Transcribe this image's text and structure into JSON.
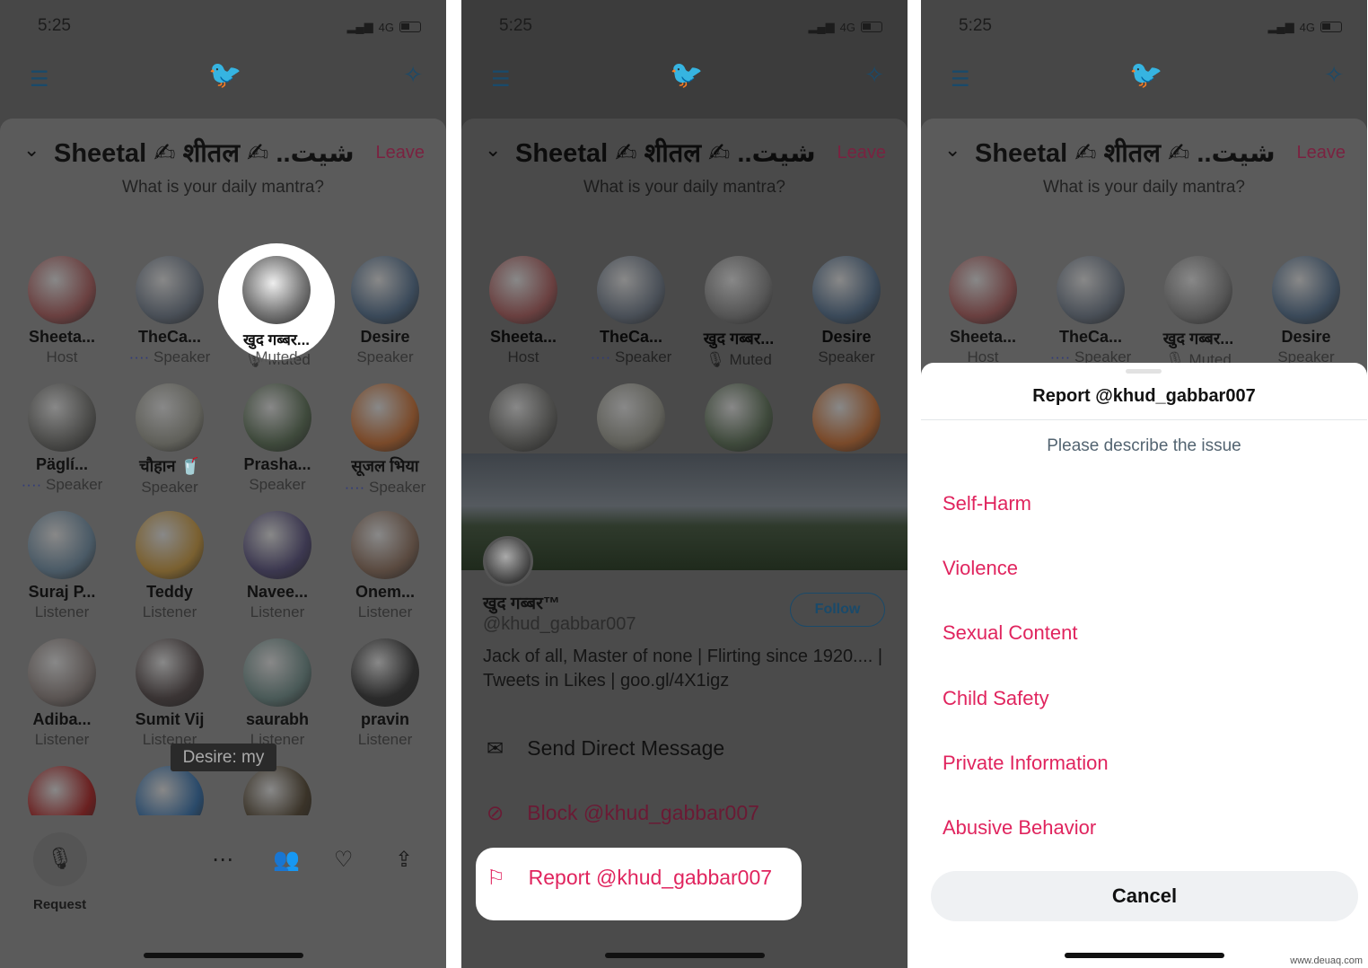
{
  "status": {
    "time": "5:25",
    "network": "4G"
  },
  "space": {
    "title": "Sheetal ✍ शीतल ✍ ..شيت",
    "leave": "Leave",
    "subtitle": "What is your daily mantra?"
  },
  "participants": [
    {
      "name": "Sheeta...",
      "role": "Host",
      "c": "#6a4040"
    },
    {
      "name": "TheCa...",
      "role": "Speaker",
      "c": "#4a5058",
      "wave": true
    },
    {
      "name": "खुद गब्बर...",
      "role": "Muted",
      "c": "#555555",
      "muted": true
    },
    {
      "name": "Desire",
      "role": "Speaker",
      "c": "#3b4a5a"
    },
    {
      "name": "Päglí...",
      "role": "Speaker",
      "c": "#4a4a48",
      "wave": true
    },
    {
      "name": "चौहान 🥤",
      "role": "Speaker",
      "c": "#60605a"
    },
    {
      "name": "Prasha...",
      "role": "Speaker",
      "c": "#3f4a3c"
    },
    {
      "name": "सूजल भिया",
      "role": "Speaker",
      "c": "#7a4a2a",
      "wave": true
    },
    {
      "name": "Suraj P...",
      "role": "Listener",
      "c": "#4a5a66"
    },
    {
      "name": "Teddy",
      "role": "Listener",
      "c": "#7a6030"
    },
    {
      "name": "Navee...",
      "role": "Listener",
      "c": "#3c3850"
    },
    {
      "name": "Onem...",
      "role": "Listener",
      "c": "#5a4a40"
    },
    {
      "name": "Adiba...",
      "role": "Listener",
      "c": "#5a5452"
    },
    {
      "name": "Sumit Vij",
      "role": "Listener",
      "c": "#3a3434"
    },
    {
      "name": "saurabh",
      "role": "Listener",
      "c": "#4a5a58"
    },
    {
      "name": "pravin",
      "role": "Listener",
      "c": "#2a2a2a"
    },
    {
      "name": "",
      "role": "",
      "c": "#6a2020"
    },
    {
      "name": "",
      "role": "",
      "c": "#2a4a6a"
    },
    {
      "name": "",
      "role": "",
      "c": "#3a3328"
    }
  ],
  "tooltip": "Desire: my",
  "bottom_bar": {
    "request": "Request",
    "icons": [
      "more-icon",
      "people-icon",
      "heart-plus-icon",
      "share-icon"
    ]
  },
  "profile": {
    "name": "खुद गब्बर™",
    "handle": "@khud_gabbar007",
    "follow": "Follow",
    "bio": "Jack of all, Master of none | Flirting since 1920.... | Tweets in Likes | goo.gl/4X1igz",
    "actions": [
      {
        "label": "Send Direct Message",
        "icon": "mail-icon"
      },
      {
        "label": "Block @khud_gabbar007",
        "icon": "block-icon"
      },
      {
        "label": "Report @khud_gabbar007",
        "icon": "flag-icon"
      }
    ]
  },
  "report": {
    "title": "Report @khud_gabbar007",
    "subtitle": "Please describe the issue",
    "options": [
      "Self-Harm",
      "Violence",
      "Sexual Content",
      "Child Safety",
      "Private Information",
      "Abusive Behavior"
    ],
    "cancel": "Cancel"
  },
  "colors": {
    "accent": "#e0245e",
    "twitter_blue": "#1da1f2"
  },
  "watermark": "www.deuaq.com"
}
